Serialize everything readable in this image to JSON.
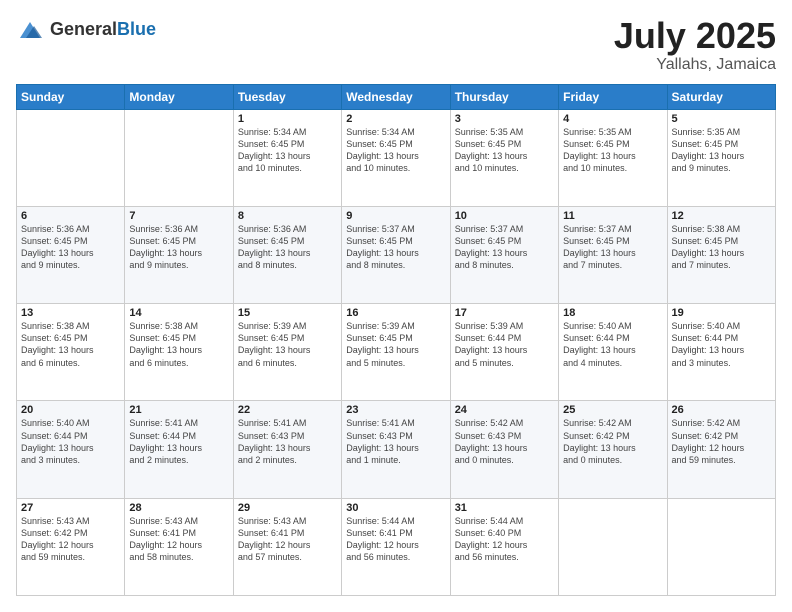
{
  "logo": {
    "general": "General",
    "blue": "Blue"
  },
  "header": {
    "month": "July 2025",
    "location": "Yallahs, Jamaica"
  },
  "weekdays": [
    "Sunday",
    "Monday",
    "Tuesday",
    "Wednesday",
    "Thursday",
    "Friday",
    "Saturday"
  ],
  "weeks": [
    [
      {
        "day": "",
        "info": ""
      },
      {
        "day": "",
        "info": ""
      },
      {
        "day": "1",
        "info": "Sunrise: 5:34 AM\nSunset: 6:45 PM\nDaylight: 13 hours\nand 10 minutes."
      },
      {
        "day": "2",
        "info": "Sunrise: 5:34 AM\nSunset: 6:45 PM\nDaylight: 13 hours\nand 10 minutes."
      },
      {
        "day": "3",
        "info": "Sunrise: 5:35 AM\nSunset: 6:45 PM\nDaylight: 13 hours\nand 10 minutes."
      },
      {
        "day": "4",
        "info": "Sunrise: 5:35 AM\nSunset: 6:45 PM\nDaylight: 13 hours\nand 10 minutes."
      },
      {
        "day": "5",
        "info": "Sunrise: 5:35 AM\nSunset: 6:45 PM\nDaylight: 13 hours\nand 9 minutes."
      }
    ],
    [
      {
        "day": "6",
        "info": "Sunrise: 5:36 AM\nSunset: 6:45 PM\nDaylight: 13 hours\nand 9 minutes."
      },
      {
        "day": "7",
        "info": "Sunrise: 5:36 AM\nSunset: 6:45 PM\nDaylight: 13 hours\nand 9 minutes."
      },
      {
        "day": "8",
        "info": "Sunrise: 5:36 AM\nSunset: 6:45 PM\nDaylight: 13 hours\nand 8 minutes."
      },
      {
        "day": "9",
        "info": "Sunrise: 5:37 AM\nSunset: 6:45 PM\nDaylight: 13 hours\nand 8 minutes."
      },
      {
        "day": "10",
        "info": "Sunrise: 5:37 AM\nSunset: 6:45 PM\nDaylight: 13 hours\nand 8 minutes."
      },
      {
        "day": "11",
        "info": "Sunrise: 5:37 AM\nSunset: 6:45 PM\nDaylight: 13 hours\nand 7 minutes."
      },
      {
        "day": "12",
        "info": "Sunrise: 5:38 AM\nSunset: 6:45 PM\nDaylight: 13 hours\nand 7 minutes."
      }
    ],
    [
      {
        "day": "13",
        "info": "Sunrise: 5:38 AM\nSunset: 6:45 PM\nDaylight: 13 hours\nand 6 minutes."
      },
      {
        "day": "14",
        "info": "Sunrise: 5:38 AM\nSunset: 6:45 PM\nDaylight: 13 hours\nand 6 minutes."
      },
      {
        "day": "15",
        "info": "Sunrise: 5:39 AM\nSunset: 6:45 PM\nDaylight: 13 hours\nand 6 minutes."
      },
      {
        "day": "16",
        "info": "Sunrise: 5:39 AM\nSunset: 6:45 PM\nDaylight: 13 hours\nand 5 minutes."
      },
      {
        "day": "17",
        "info": "Sunrise: 5:39 AM\nSunset: 6:44 PM\nDaylight: 13 hours\nand 5 minutes."
      },
      {
        "day": "18",
        "info": "Sunrise: 5:40 AM\nSunset: 6:44 PM\nDaylight: 13 hours\nand 4 minutes."
      },
      {
        "day": "19",
        "info": "Sunrise: 5:40 AM\nSunset: 6:44 PM\nDaylight: 13 hours\nand 3 minutes."
      }
    ],
    [
      {
        "day": "20",
        "info": "Sunrise: 5:40 AM\nSunset: 6:44 PM\nDaylight: 13 hours\nand 3 minutes."
      },
      {
        "day": "21",
        "info": "Sunrise: 5:41 AM\nSunset: 6:44 PM\nDaylight: 13 hours\nand 2 minutes."
      },
      {
        "day": "22",
        "info": "Sunrise: 5:41 AM\nSunset: 6:43 PM\nDaylight: 13 hours\nand 2 minutes."
      },
      {
        "day": "23",
        "info": "Sunrise: 5:41 AM\nSunset: 6:43 PM\nDaylight: 13 hours\nand 1 minute."
      },
      {
        "day": "24",
        "info": "Sunrise: 5:42 AM\nSunset: 6:43 PM\nDaylight: 13 hours\nand 0 minutes."
      },
      {
        "day": "25",
        "info": "Sunrise: 5:42 AM\nSunset: 6:42 PM\nDaylight: 13 hours\nand 0 minutes."
      },
      {
        "day": "26",
        "info": "Sunrise: 5:42 AM\nSunset: 6:42 PM\nDaylight: 12 hours\nand 59 minutes."
      }
    ],
    [
      {
        "day": "27",
        "info": "Sunrise: 5:43 AM\nSunset: 6:42 PM\nDaylight: 12 hours\nand 59 minutes."
      },
      {
        "day": "28",
        "info": "Sunrise: 5:43 AM\nSunset: 6:41 PM\nDaylight: 12 hours\nand 58 minutes."
      },
      {
        "day": "29",
        "info": "Sunrise: 5:43 AM\nSunset: 6:41 PM\nDaylight: 12 hours\nand 57 minutes."
      },
      {
        "day": "30",
        "info": "Sunrise: 5:44 AM\nSunset: 6:41 PM\nDaylight: 12 hours\nand 56 minutes."
      },
      {
        "day": "31",
        "info": "Sunrise: 5:44 AM\nSunset: 6:40 PM\nDaylight: 12 hours\nand 56 minutes."
      },
      {
        "day": "",
        "info": ""
      },
      {
        "day": "",
        "info": ""
      }
    ]
  ]
}
